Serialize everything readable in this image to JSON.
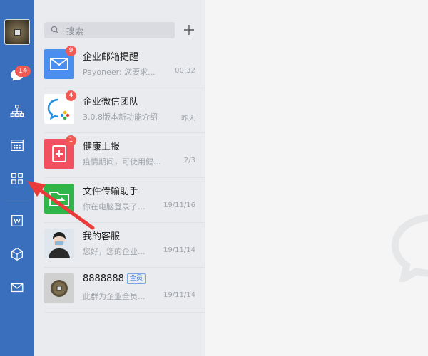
{
  "rail": {
    "chat_badge": "14"
  },
  "search": {
    "placeholder": "搜索"
  },
  "conversations": [
    {
      "title": "企业邮箱提醒",
      "subtitle": "Payoneer: 您要求...",
      "time": "00:32",
      "badge": "9",
      "avatar_icon": "mail-icon",
      "avatar_color": "#4a8ef0"
    },
    {
      "title": "企业微信团队",
      "subtitle": "3.0.8版本新功能介绍",
      "time": "昨天",
      "badge": "4",
      "avatar_icon": "wecom-logo-icon",
      "avatar_color": "#ffffff"
    },
    {
      "title": "健康上报",
      "subtitle": "疫情期间，可使用健...",
      "time": "2/3",
      "badge": "1",
      "avatar_icon": "health-report-icon",
      "avatar_color": "#f0505f"
    },
    {
      "title": "文件传输助手",
      "subtitle": "你在电脑登录了...",
      "time": "19/11/16",
      "badge": "",
      "avatar_icon": "file-transfer-icon",
      "avatar_color": "#2fb54a"
    },
    {
      "title": "我的客服",
      "subtitle": "您好，您的企业...",
      "time": "19/11/14",
      "badge": "",
      "avatar_icon": "customer-service-avatar",
      "avatar_color": "#dfe6ee"
    },
    {
      "title": "8888888",
      "tag": "全员",
      "subtitle": "此群为企业全员...",
      "time": "19/11/14",
      "badge": "",
      "avatar_icon": "coin-avatar",
      "avatar_color": "#d0d0d0"
    }
  ],
  "colors": {
    "rail": "#3a6fbd",
    "badge": "#f25b55",
    "list_bg": "#e9ebee"
  }
}
